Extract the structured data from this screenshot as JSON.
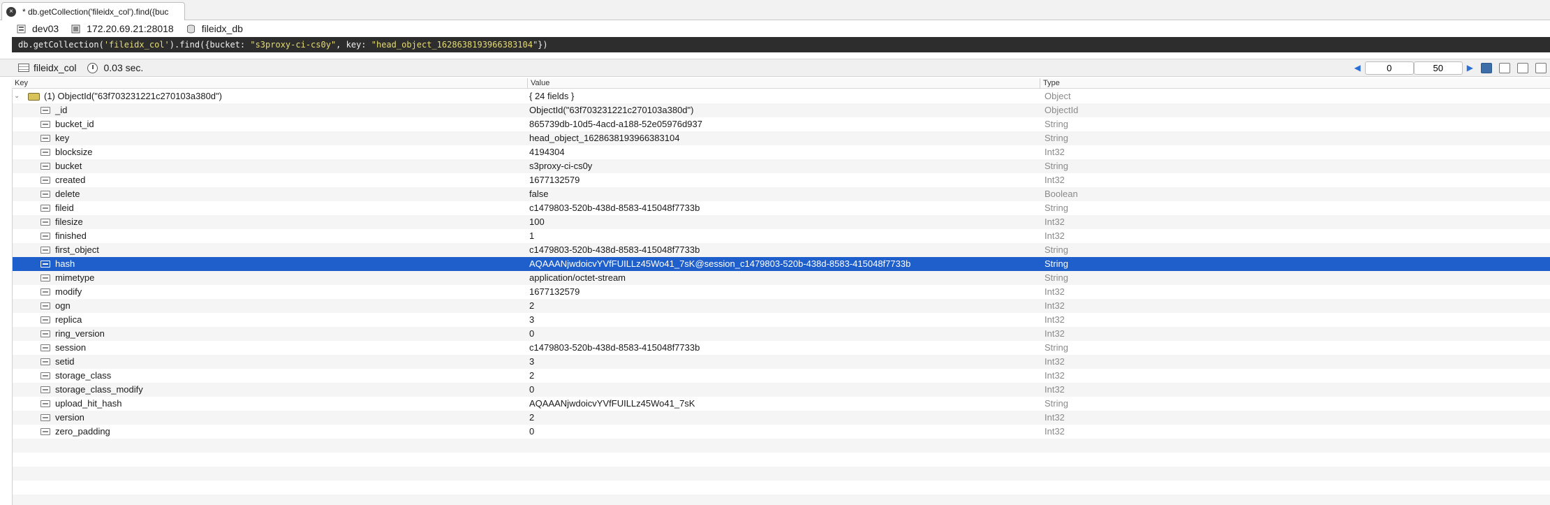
{
  "tab": {
    "close_glyph": "×",
    "title": "* db.getCollection('fileidx_col').find({buc"
  },
  "connection": {
    "server": "dev03",
    "host": "172.20.69.21:28018",
    "database": "fileidx_db"
  },
  "query": {
    "prefix": "db.getCollection(",
    "collection_arg": "'fileidx_col'",
    "find": ").find({bucket: ",
    "bucket_val": "\"s3proxy-ci-cs0y\"",
    "key_part": ", key: ",
    "key_val": "\"head_object_1628638193966383104\"",
    "suffix": "})"
  },
  "result": {
    "collection": "fileidx_col",
    "time": "0.03 sec.",
    "page_start": "0",
    "page_size": "50",
    "prev_glyph": "◀",
    "next_glyph": "▶"
  },
  "columns": {
    "key": "Key",
    "value": "Value",
    "type": "Type"
  },
  "root": {
    "chevron": "⌄",
    "key": "(1) ObjectId(\"63f703231221c270103a380d\")",
    "value": "{ 24 fields }",
    "type": "Object"
  },
  "fields": [
    {
      "key": "_id",
      "value": "ObjectId(\"63f703231221c270103a380d\")",
      "type": "ObjectId"
    },
    {
      "key": "bucket_id",
      "value": "865739db-10d5-4acd-a188-52e05976d937",
      "type": "String"
    },
    {
      "key": "key",
      "value": "head_object_1628638193966383104",
      "type": "String"
    },
    {
      "key": "blocksize",
      "value": "4194304",
      "type": "Int32"
    },
    {
      "key": "bucket",
      "value": "s3proxy-ci-cs0y",
      "type": "String"
    },
    {
      "key": "created",
      "value": "1677132579",
      "type": "Int32"
    },
    {
      "key": "delete",
      "value": "false",
      "type": "Boolean"
    },
    {
      "key": "fileid",
      "value": "c1479803-520b-438d-8583-415048f7733b",
      "type": "String"
    },
    {
      "key": "filesize",
      "value": "100",
      "type": "Int32"
    },
    {
      "key": "finished",
      "value": "1",
      "type": "Int32"
    },
    {
      "key": "first_object",
      "value": "c1479803-520b-438d-8583-415048f7733b",
      "type": "String"
    },
    {
      "key": "hash",
      "value": "AQAAANjwdoicvYVfFUILLz45Wo41_7sK@session_c1479803-520b-438d-8583-415048f7733b",
      "type": "String",
      "selected": true
    },
    {
      "key": "mimetype",
      "value": "application/octet-stream",
      "type": "String"
    },
    {
      "key": "modify",
      "value": "1677132579",
      "type": "Int32"
    },
    {
      "key": "ogn",
      "value": "2",
      "type": "Int32"
    },
    {
      "key": "replica",
      "value": "3",
      "type": "Int32"
    },
    {
      "key": "ring_version",
      "value": "0",
      "type": "Int32"
    },
    {
      "key": "session",
      "value": "c1479803-520b-438d-8583-415048f7733b",
      "type": "String"
    },
    {
      "key": "setid",
      "value": "3",
      "type": "Int32"
    },
    {
      "key": "storage_class",
      "value": "2",
      "type": "Int32"
    },
    {
      "key": "storage_class_modify",
      "value": "0",
      "type": "Int32"
    },
    {
      "key": "upload_hit_hash",
      "value": "AQAAANjwdoicvYVfFUILLz45Wo41_7sK",
      "type": "String"
    },
    {
      "key": "version",
      "value": "2",
      "type": "Int32"
    },
    {
      "key": "zero_padding",
      "value": "0",
      "type": "Int32"
    }
  ],
  "colors": {
    "selection": "#1f5fcc",
    "query_bg": "#2d2d2d",
    "query_string": "#e6db74",
    "accent": "#2a6fd6"
  }
}
